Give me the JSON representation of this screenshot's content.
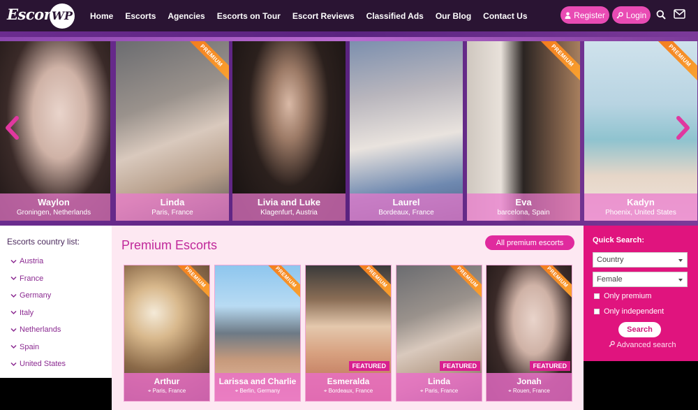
{
  "header": {
    "logo_text": "Escort",
    "logo_badge": "WP",
    "nav": [
      "Home",
      "Escorts",
      "Agencies",
      "Escorts on Tour",
      "Escort Reviews",
      "Classified Ads",
      "Our Blog",
      "Contact Us"
    ],
    "register_label": "Register",
    "login_label": "Login"
  },
  "carousel": {
    "slides": [
      {
        "name": "Waylon",
        "location": "Groningen, Netherlands",
        "premium": false
      },
      {
        "name": "Linda",
        "location": "Paris, France",
        "premium": true
      },
      {
        "name": "Livia and Luke",
        "location": "Klagenfurt, Austria",
        "premium": false
      },
      {
        "name": "Laurel",
        "location": "Bordeaux, France",
        "premium": false
      },
      {
        "name": "Eva",
        "location": "barcelona, Spain",
        "premium": true
      },
      {
        "name": "Kadyn",
        "location": "Phoenix, United States",
        "premium": true
      }
    ],
    "ribbon_label": "PREMIUM"
  },
  "sidebar": {
    "heading": "Escorts country list:",
    "countries": [
      "Austria",
      "France",
      "Germany",
      "Italy",
      "Netherlands",
      "Spain",
      "United States"
    ]
  },
  "premium": {
    "title": "Premium Escorts",
    "all_button": "All premium escorts",
    "featured_label": "FEATURED",
    "cards": [
      {
        "name": "Arthur",
        "location": "Paris, France",
        "featured": false
      },
      {
        "name": "Larissa and Charlie",
        "location": "Berlin, Germany",
        "featured": false
      },
      {
        "name": "Esmeralda",
        "location": "Bordeaux, France",
        "featured": true
      },
      {
        "name": "Linda",
        "location": "Paris, France",
        "featured": true
      },
      {
        "name": "Jonah",
        "location": "Rouen, France",
        "featured": true
      }
    ]
  },
  "quick_search": {
    "heading": "Quick Search:",
    "country_value": "Country",
    "gender_value": "Female",
    "only_premium": "Only premium",
    "only_independent": "Only independent",
    "search_button": "Search",
    "advanced_link": "Advanced search"
  }
}
